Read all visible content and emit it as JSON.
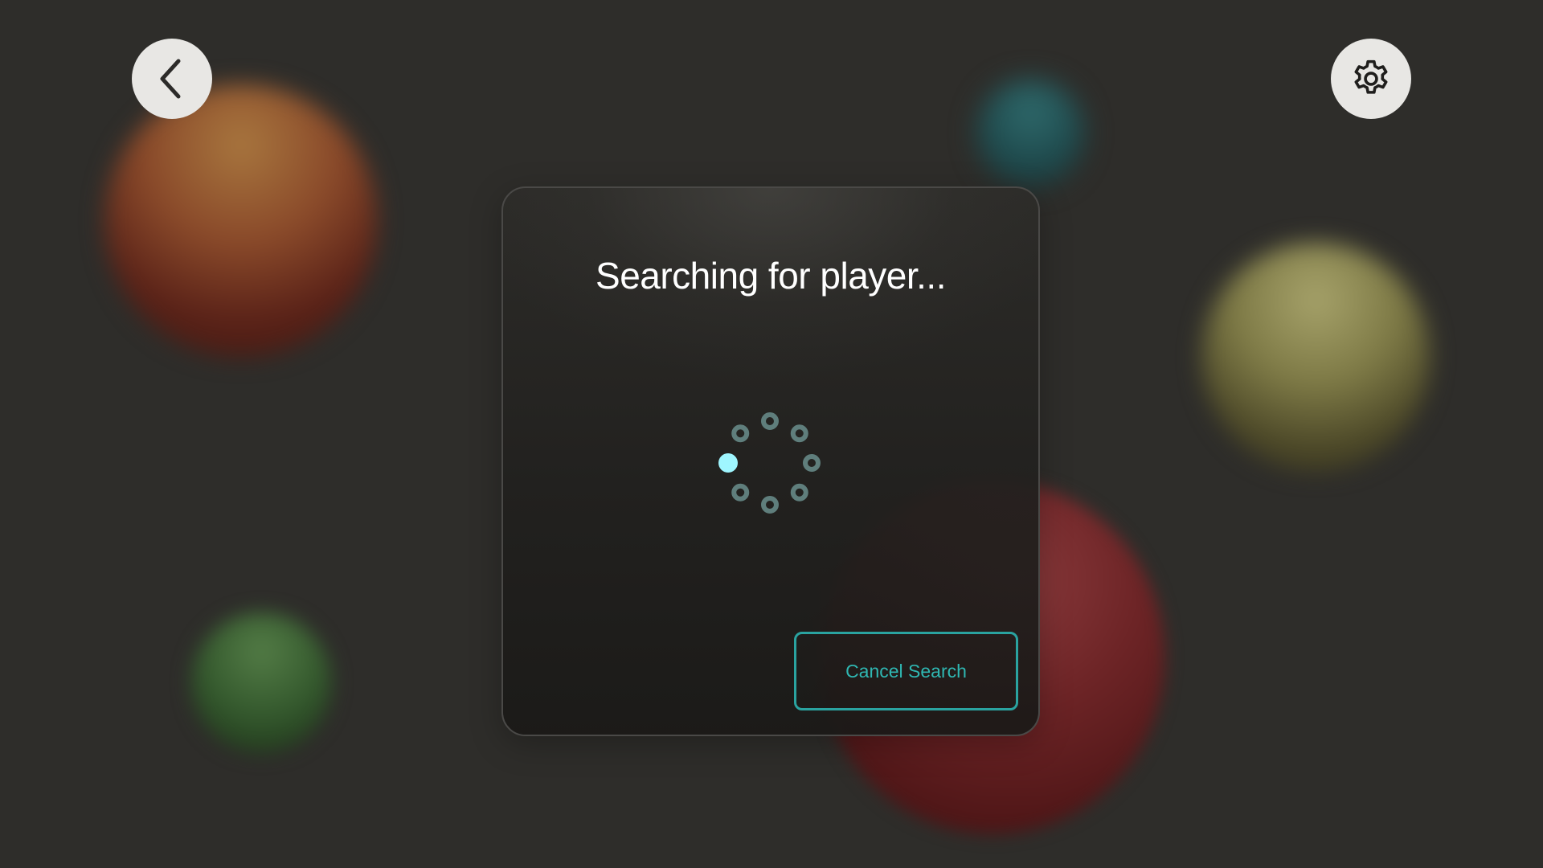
{
  "header": {
    "back_icon": "chevron-left-icon",
    "settings_icon": "gear-icon"
  },
  "dialog": {
    "title": "Searching for player...",
    "cancel_label": "Cancel Search"
  },
  "spinner": {
    "dot_count": 8,
    "active_dot_index": 6
  },
  "colors": {
    "background": "#2e2d2a",
    "accent": "#2aa3a0",
    "spinner_active": "#9ff6ff",
    "spinner_idle": "#5f7e7c"
  }
}
